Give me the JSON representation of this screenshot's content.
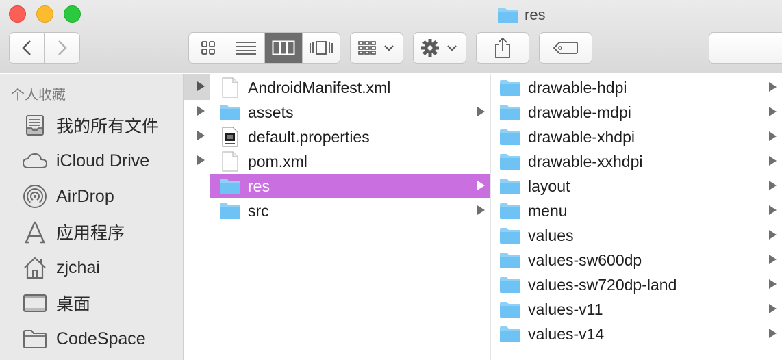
{
  "window": {
    "title": "res"
  },
  "toolbar": {
    "back_icon": "chevron-left-icon",
    "forward_icon": "chevron-right-icon",
    "view_modes": [
      "icon-view",
      "list-view",
      "column-view",
      "cover-flow-view"
    ],
    "active_view": "column-view",
    "arrange_icon": "arrange-grid-icon",
    "action_icon": "gear-icon",
    "share_icon": "share-icon",
    "tag_icon": "tag-icon"
  },
  "sidebar": {
    "header": "个人收藏",
    "items": [
      {
        "label": "我的所有文件",
        "icon": "all-files-icon"
      },
      {
        "label": "iCloud Drive",
        "icon": "cloud-icon"
      },
      {
        "label": "AirDrop",
        "icon": "airdrop-icon"
      },
      {
        "label": "应用程序",
        "icon": "applications-icon"
      },
      {
        "label": "zjchai",
        "icon": "home-icon"
      },
      {
        "label": "桌面",
        "icon": "desktop-icon"
      },
      {
        "label": "CodeSpace",
        "icon": "folder-icon"
      }
    ]
  },
  "column2": {
    "items": [
      {
        "name": "AndroidManifest.xml",
        "type": "file",
        "icon": "document-icon"
      },
      {
        "name": "assets",
        "type": "folder",
        "icon": "folder-icon"
      },
      {
        "name": "default.properties",
        "type": "file",
        "icon": "java-file-icon"
      },
      {
        "name": "pom.xml",
        "type": "file",
        "icon": "document-icon"
      },
      {
        "name": "res",
        "type": "folder",
        "icon": "folder-icon",
        "selected": true
      },
      {
        "name": "src",
        "type": "folder",
        "icon": "folder-icon"
      }
    ]
  },
  "column3": {
    "items": [
      {
        "name": "drawable-hdpi"
      },
      {
        "name": "drawable-mdpi"
      },
      {
        "name": "drawable-xhdpi"
      },
      {
        "name": "drawable-xxhdpi"
      },
      {
        "name": "layout"
      },
      {
        "name": "menu"
      },
      {
        "name": "values"
      },
      {
        "name": "values-sw600dp"
      },
      {
        "name": "values-sw720dp-land"
      },
      {
        "name": "values-v11"
      },
      {
        "name": "values-v14"
      }
    ]
  },
  "colors": {
    "selection": "#c96fe0",
    "folder": "#6ec3f4",
    "sidebar_bg": "#e9e9e9"
  }
}
